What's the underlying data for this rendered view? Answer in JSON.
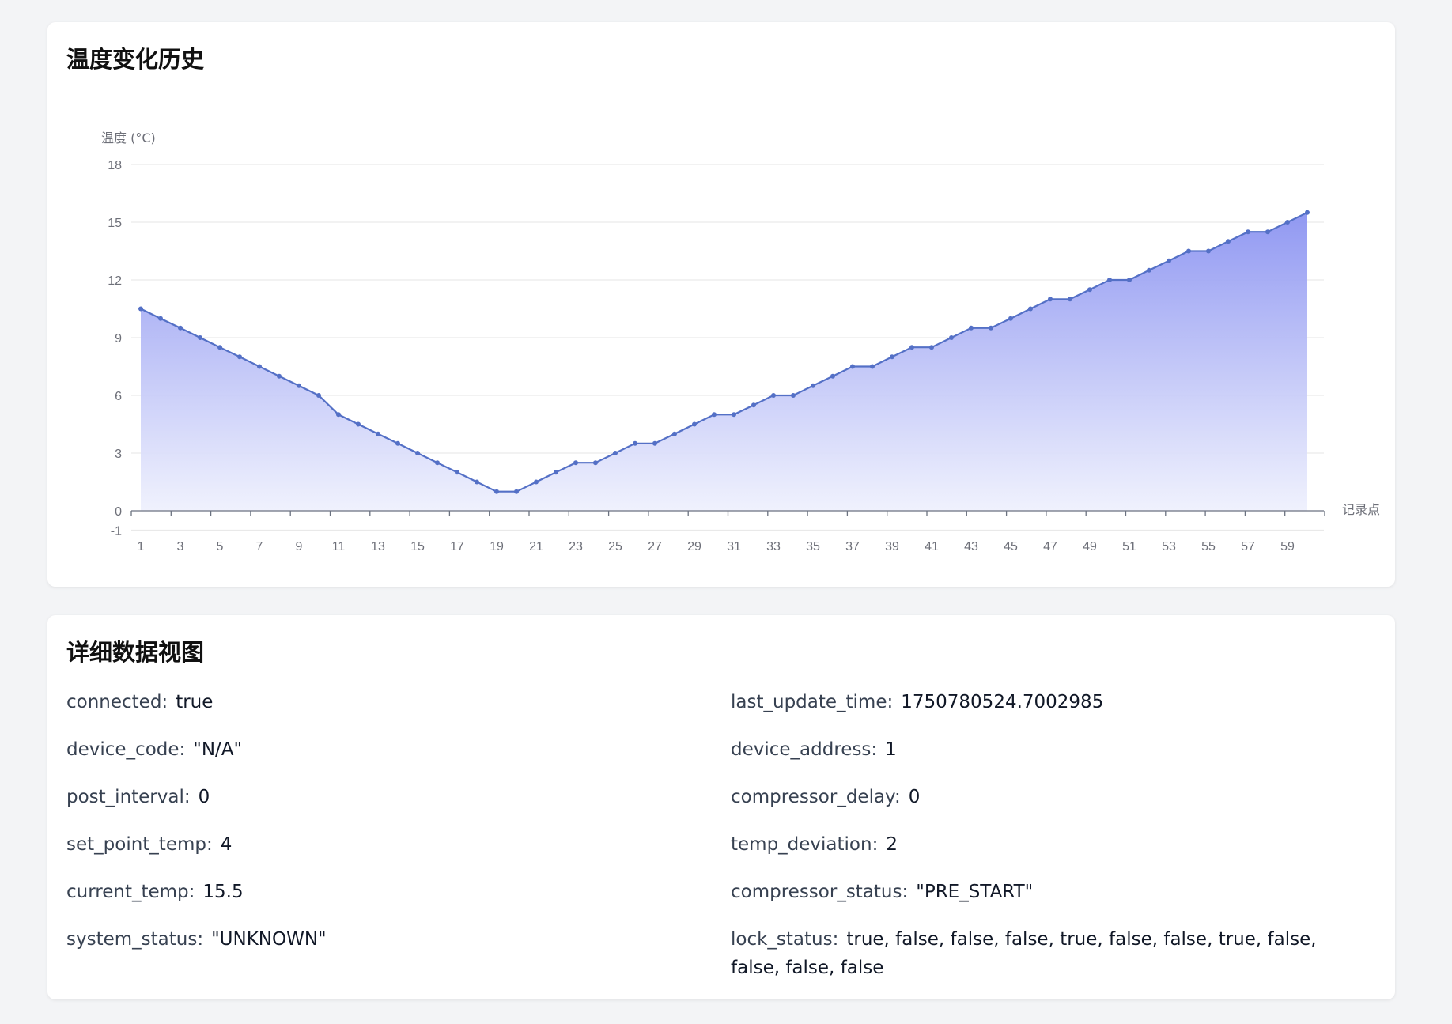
{
  "chart_section": {
    "title": "温度变化历史"
  },
  "detail_section": {
    "title": "详细数据视图",
    "left": [
      {
        "key": "connected:",
        "value": "true"
      },
      {
        "key": "device_code:",
        "value": "\"N/A\""
      },
      {
        "key": "post_interval:",
        "value": "0"
      },
      {
        "key": "set_point_temp:",
        "value": "4"
      },
      {
        "key": "current_temp:",
        "value": "15.5"
      },
      {
        "key": "system_status:",
        "value": "\"UNKNOWN\""
      }
    ],
    "right": [
      {
        "key": "last_update_time:",
        "value": "1750780524.7002985"
      },
      {
        "key": "device_address:",
        "value": "1"
      },
      {
        "key": "compressor_delay:",
        "value": "0"
      },
      {
        "key": "temp_deviation:",
        "value": "2"
      },
      {
        "key": "compressor_status:",
        "value": "\"PRE_START\""
      },
      {
        "key": "lock_status:",
        "value": "true, false, false, false, true, false, false, true, false, false, false, false"
      }
    ]
  },
  "chart_data": {
    "type": "area",
    "ylabel": "温度 (°C)",
    "xlabel": "记录点",
    "ylim": [
      -1,
      18
    ],
    "yticks": [
      -1,
      0,
      3,
      6,
      9,
      12,
      15,
      18
    ],
    "x": [
      1,
      2,
      3,
      4,
      5,
      6,
      7,
      8,
      9,
      10,
      11,
      12,
      13,
      14,
      15,
      16,
      17,
      18,
      19,
      20,
      21,
      22,
      23,
      24,
      25,
      26,
      27,
      28,
      29,
      30,
      31,
      32,
      33,
      34,
      35,
      36,
      37,
      38,
      39,
      40,
      41,
      42,
      43,
      44,
      45,
      46,
      47,
      48,
      49,
      50,
      51,
      52,
      53,
      54,
      55,
      56,
      57,
      58,
      59,
      60
    ],
    "xtick_labels": [
      "1",
      "3",
      "5",
      "7",
      "9",
      "11",
      "13",
      "15",
      "17",
      "19",
      "21",
      "23",
      "25",
      "27",
      "29",
      "31",
      "33",
      "35",
      "37",
      "39",
      "41",
      "43",
      "45",
      "47",
      "49",
      "51",
      "53",
      "55",
      "57",
      "59"
    ],
    "series": [
      {
        "values": [
          10.5,
          10,
          9.5,
          9,
          8.5,
          8,
          7.5,
          7,
          6.5,
          6,
          5,
          4.5,
          4,
          3.5,
          3,
          2.5,
          2,
          1.5,
          1,
          1,
          1.5,
          2,
          2.5,
          2.5,
          3,
          3.5,
          3.5,
          4,
          4.5,
          5,
          5,
          5.5,
          6,
          6,
          6.5,
          7,
          7.5,
          7.5,
          8,
          8.5,
          8.5,
          9,
          9.5,
          9.5,
          10,
          10.5,
          11,
          11,
          11.5,
          12,
          12,
          12.5,
          13,
          13.5,
          13.5,
          14,
          14.5,
          14.5,
          15,
          15.5
        ]
      }
    ],
    "grid": true,
    "colors": {
      "line": "#5470c6",
      "area_top": "#8b93f1",
      "area_bottom": "#eef0fd"
    }
  }
}
